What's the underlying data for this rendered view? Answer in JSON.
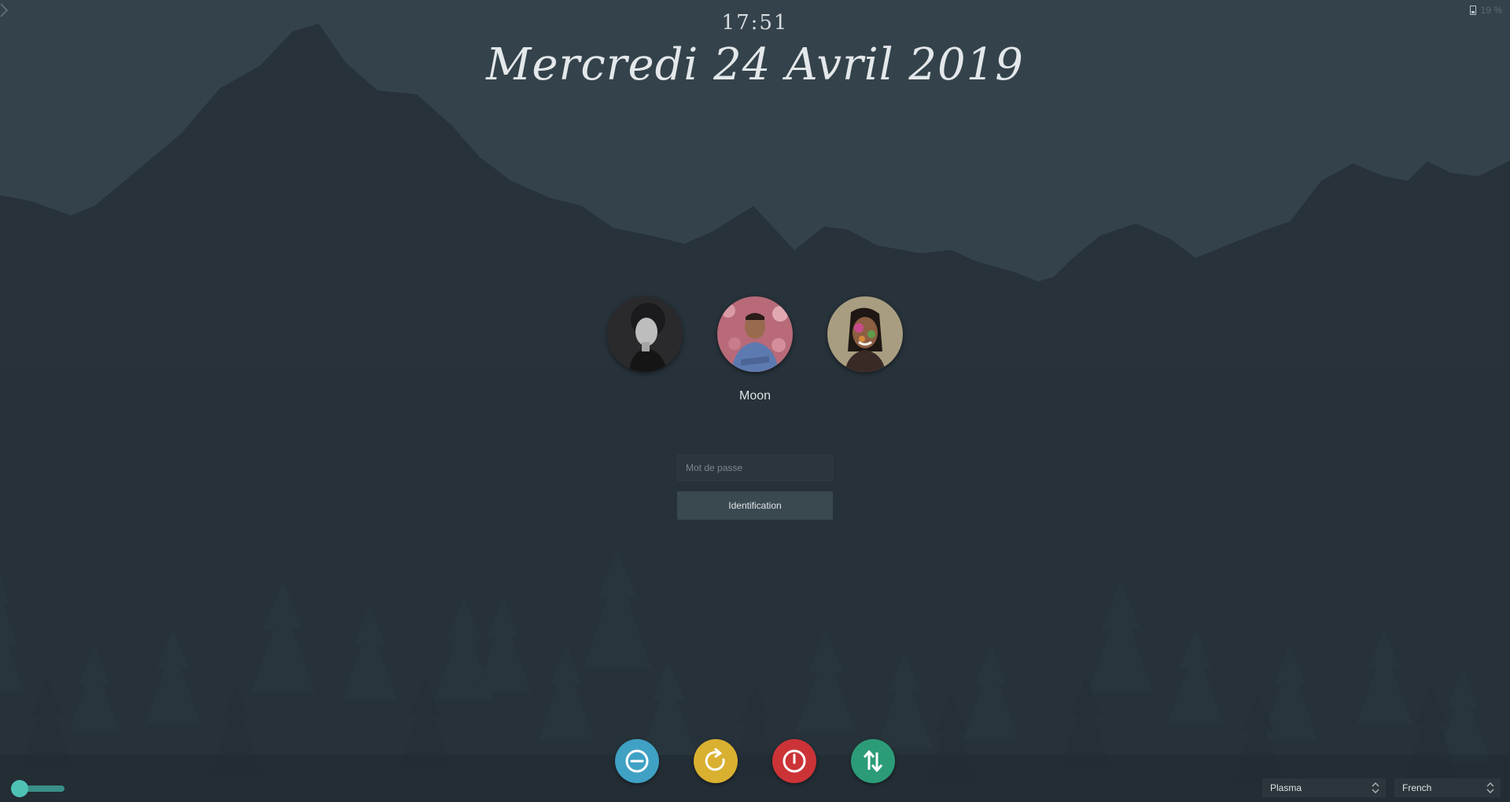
{
  "screen": {
    "time": "17:51",
    "date": "Mercredi 24 Avril 2019",
    "battery_percent": "19 %"
  },
  "users": {
    "selected_name": "Moon",
    "avatars": [
      {
        "label": "user-1",
        "style": "bw-portrait"
      },
      {
        "label": "user-2",
        "style": "floral-portrait"
      },
      {
        "label": "user-3",
        "style": "holi-portrait"
      }
    ]
  },
  "login": {
    "password_placeholder": "Mot de passe",
    "password_value": "",
    "button_label": "Identification"
  },
  "power_actions": [
    {
      "name": "suspend",
      "color": "#3fa1c4"
    },
    {
      "name": "reboot",
      "color": "#d9b030"
    },
    {
      "name": "shutdown",
      "color": "#cc3337"
    },
    {
      "name": "switch-user",
      "color": "#2c9c78"
    }
  ],
  "bottom_bar": {
    "session": "Plasma",
    "language": "French",
    "virtual_keyboard_toggle": "on"
  },
  "colors": {
    "sky": "#34434b",
    "mountains": "#27323a",
    "forest": "#222c32",
    "accent": "#4ec2b5"
  }
}
